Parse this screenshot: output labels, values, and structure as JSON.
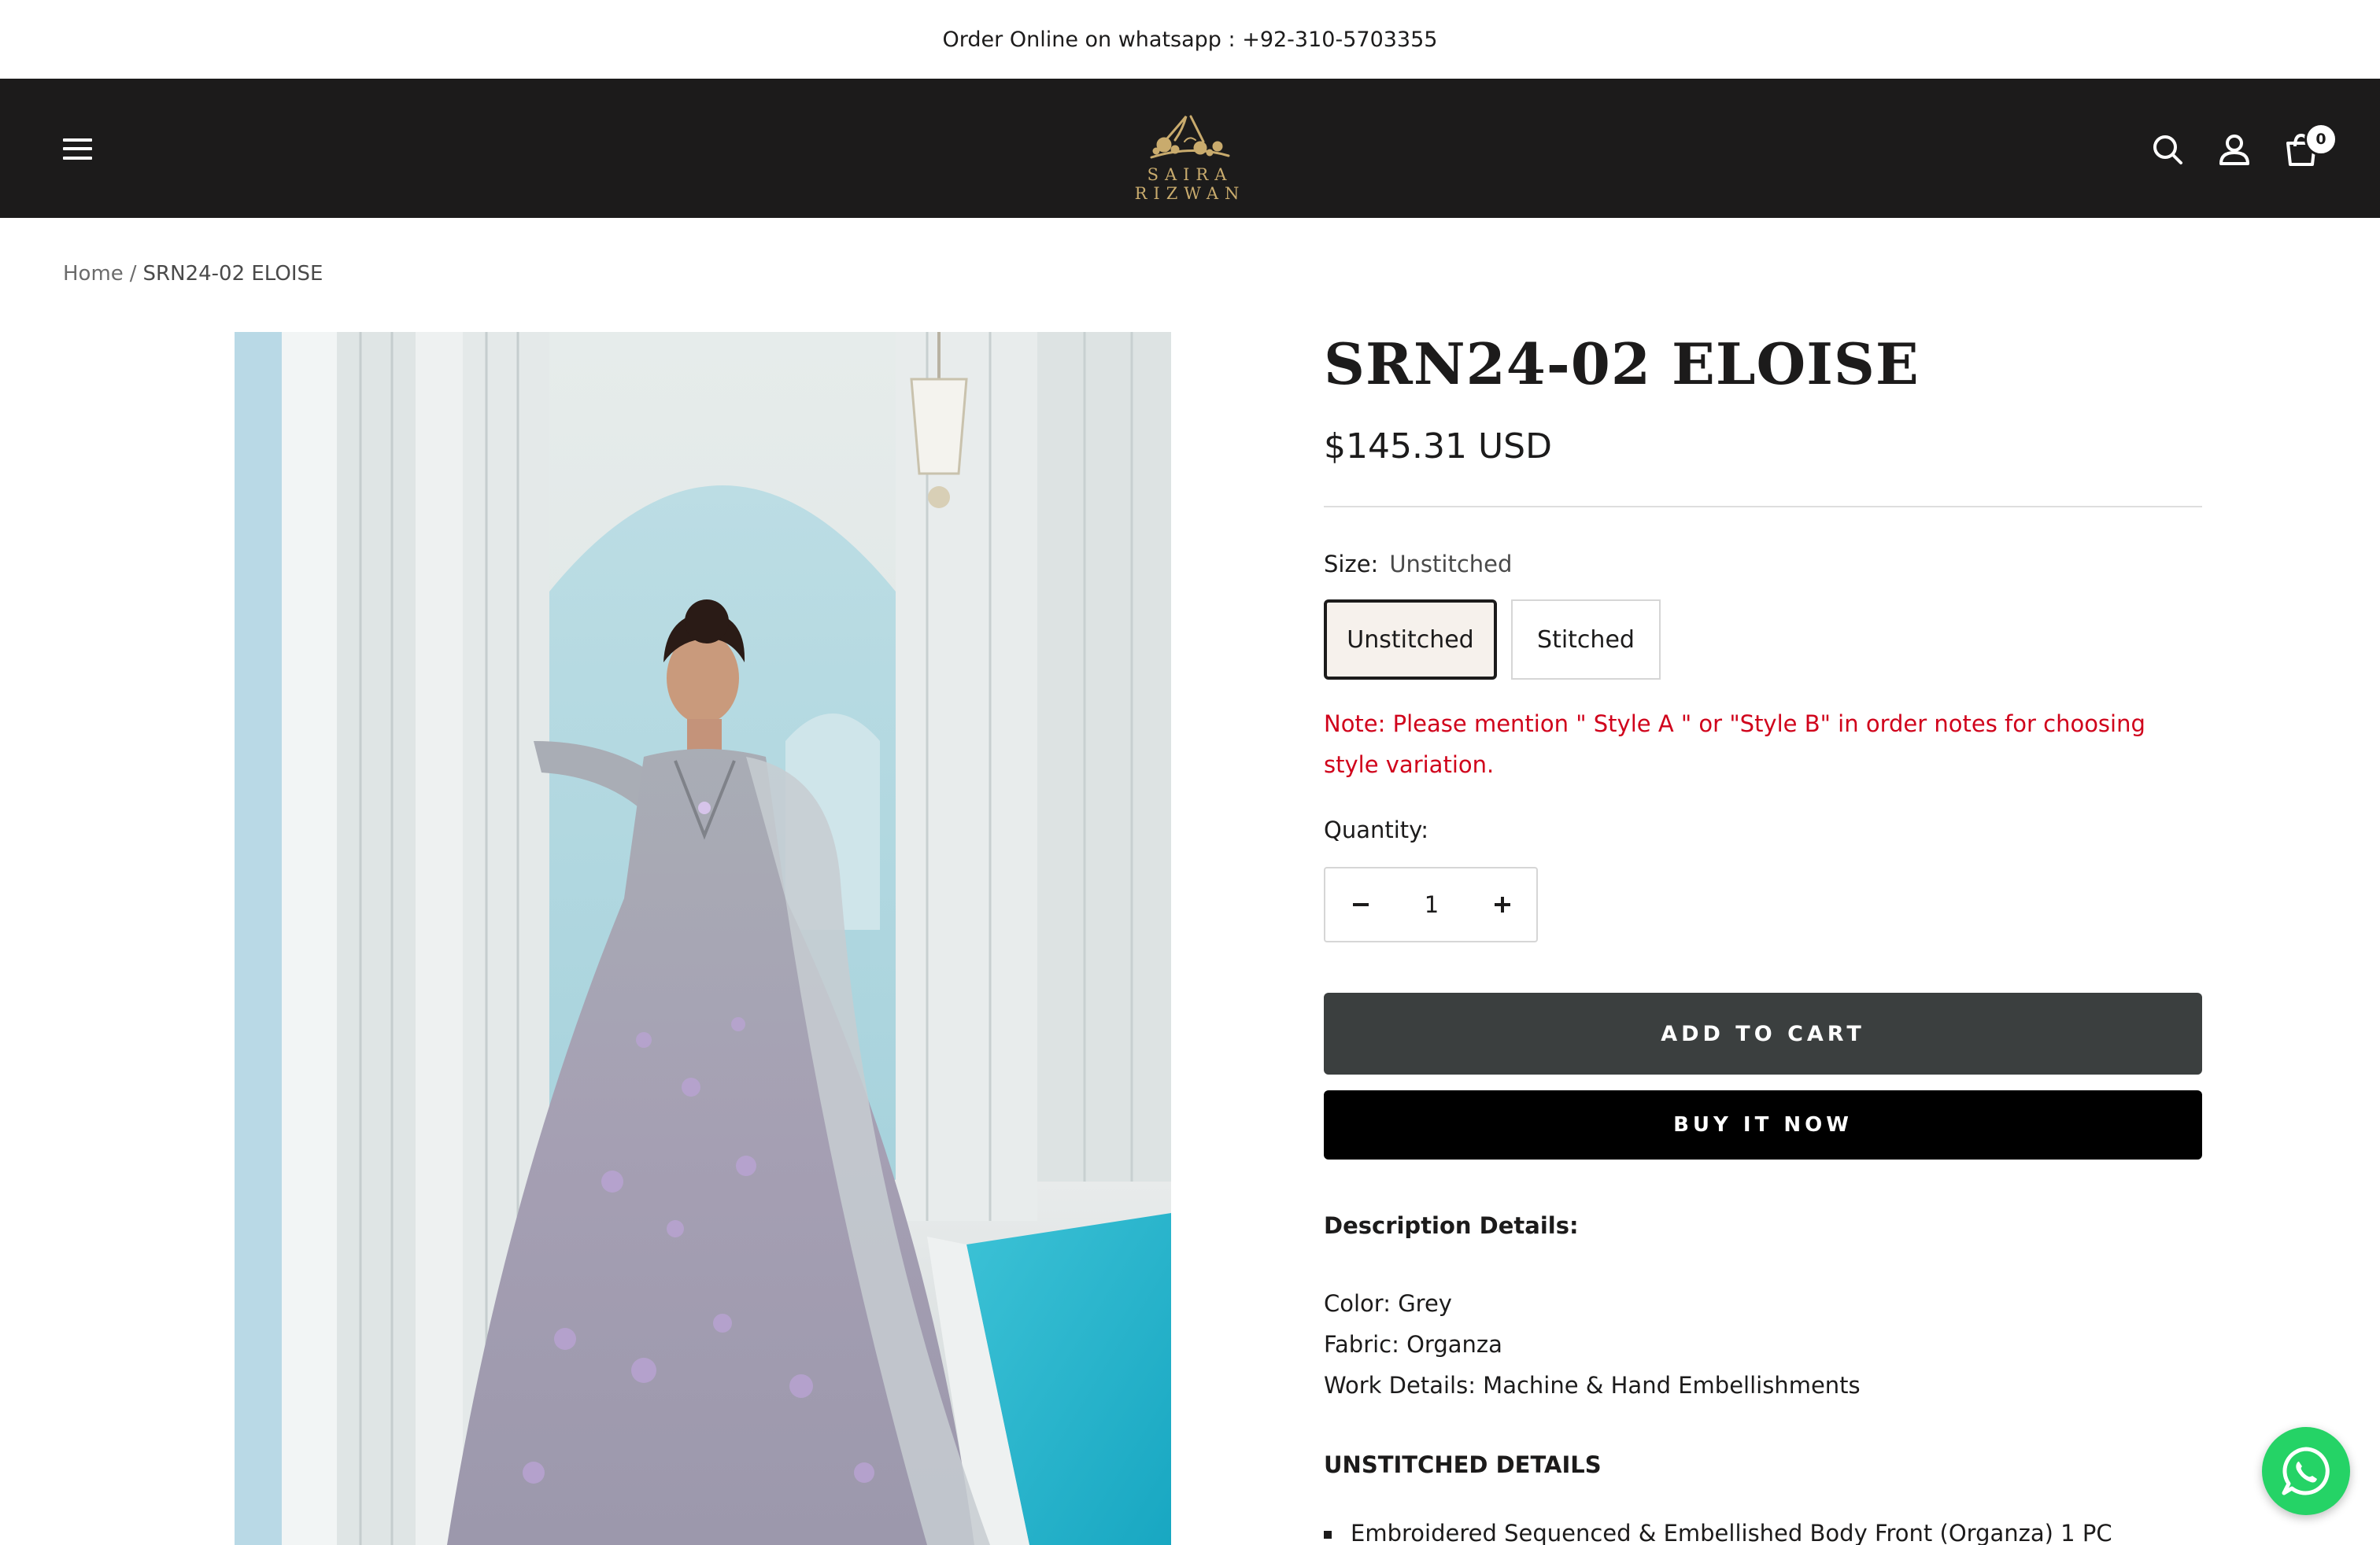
{
  "announcement": {
    "text": "Order Online on whatsapp : +92-310-5703355"
  },
  "header": {
    "logo_text": "SAIRA RIZWAN",
    "cart_count": "0",
    "colors": {
      "background": "#1c1b1b",
      "logo_gold": "#c9ab6d"
    },
    "icons": [
      "menu-icon",
      "search-icon",
      "account-icon",
      "cart-icon"
    ]
  },
  "breadcrumb": {
    "home": "Home",
    "separator": "/",
    "current": "SRN24-02 ELOISE"
  },
  "product": {
    "title": "SRN24-02 ELOISE",
    "price": "$145.31 USD",
    "size_label": "Size:",
    "size_value": "Unstitched",
    "size_options": [
      "Unstitched",
      "Stitched"
    ],
    "note": "Note: Please mention \" Style A \" or \"Style B\" in order notes for choosing style variation.",
    "quantity_label": "Quantity:",
    "quantity": "1",
    "add_to_cart": "ADD TO CART",
    "buy_now": "BUY IT NOW",
    "description_heading": "Description Details:",
    "description": [
      "Color: Grey",
      "Fabric: Organza",
      "Work Details: Machine & Hand Embellishments"
    ],
    "unstitched_heading": "UNSTITCHED DETAILS",
    "unstitched_items": [
      "Embroidered Sequenced & Embellished Body Front (Organza) 1 PC"
    ],
    "colors": {
      "note_red": "#d0021b",
      "add_to_cart_bg": "#3b3f3f",
      "buy_now_bg": "#000000",
      "whatsapp_green": "#25d366"
    }
  }
}
